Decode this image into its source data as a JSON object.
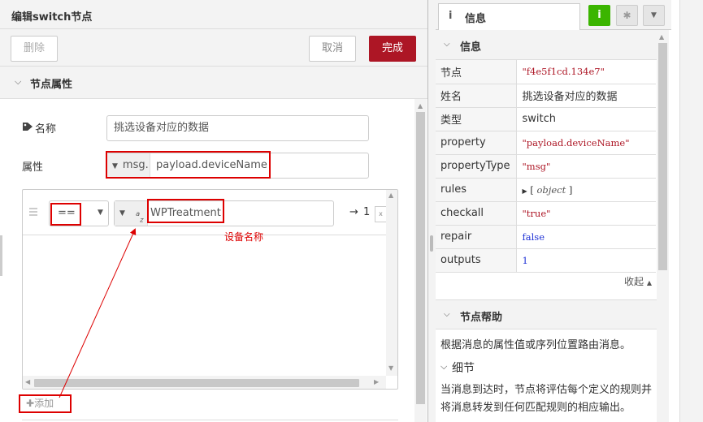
{
  "editor": {
    "title": "编辑switch节点",
    "delete_label": "删除",
    "cancel_label": "取消",
    "done_label": "完成",
    "section_title": "节点属性",
    "name_label": "名称",
    "name_value": "挑选设备对应的数据",
    "property_label": "属性",
    "property_type": "msg.",
    "property_value": "payload.deviceName",
    "rule": {
      "operator": "==",
      "value_type_glyph": "a",
      "value_type_sub": "z",
      "value": "WPTreatment",
      "output_arrow": "→",
      "output_number": "1",
      "remove_glyph": "x"
    },
    "annotation": "设备名称",
    "add_label": "添加"
  },
  "sidebar": {
    "tab_label": "信息",
    "tab_icon": "i",
    "info_button": "i",
    "bug_button": "✱",
    "section_title": "信息",
    "rows": [
      {
        "key": "节点",
        "value": "\"f4e5f1cd.134e7\""
      },
      {
        "key": "姓名",
        "value": "挑选设备对应的数据"
      },
      {
        "key": "类型",
        "value": "switch"
      },
      {
        "key": "property",
        "value": "\"payload.deviceName\""
      },
      {
        "key": "propertyType",
        "value": "\"msg\""
      },
      {
        "key": "rules",
        "value": "object"
      },
      {
        "key": "checkall",
        "value": "\"true\""
      },
      {
        "key": "repair",
        "value": "false"
      },
      {
        "key": "outputs",
        "value": "1"
      }
    ],
    "collapse_label": "收起",
    "help_title": "节点帮助",
    "help_summary": "根据消息的属性值或序列位置路由消息。",
    "details_title": "细节",
    "help_details": "当消息到达时，节点将评估每个定义的规则并将消息转发到任何匹配规则的相应输出。"
  },
  "colors": {
    "accent_red": "#ad1625",
    "highlight_red": "#dd0000",
    "info_green": "#3bb500",
    "number_blue": "#2033d6"
  }
}
